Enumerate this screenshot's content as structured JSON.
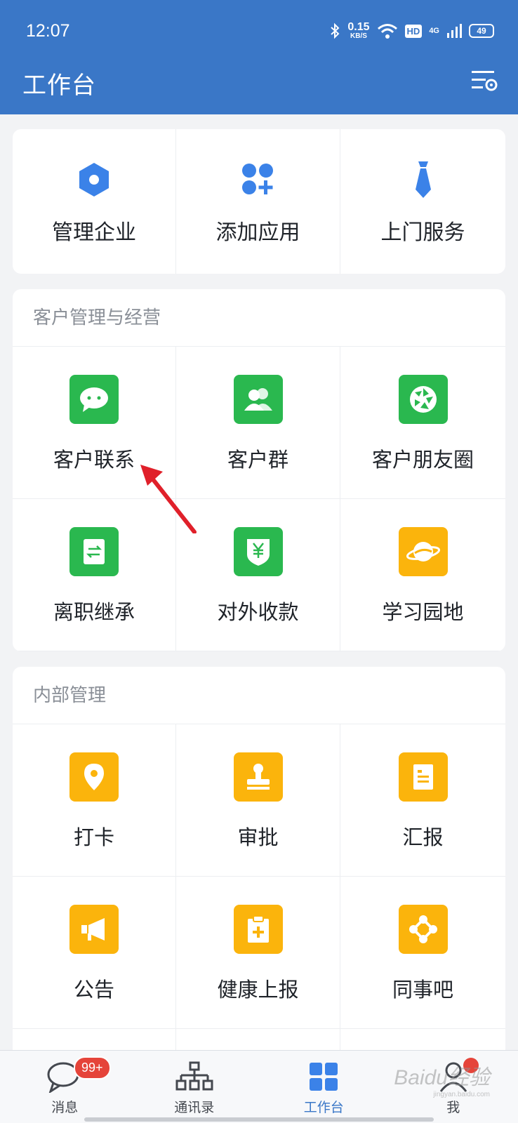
{
  "status_bar": {
    "time": "12:07",
    "speed": "0.15",
    "speed_unit": "KB/S",
    "hd": "HD",
    "network": "4G",
    "battery": "49"
  },
  "header": {
    "title": "工作台"
  },
  "quick_actions": [
    {
      "label": "管理企业",
      "icon": "hexagon-settings-icon"
    },
    {
      "label": "添加应用",
      "icon": "add-app-icon"
    },
    {
      "label": "上门服务",
      "icon": "necktie-icon"
    }
  ],
  "customer_section": {
    "title": "客户管理与经营",
    "items": [
      {
        "label": "客户联系",
        "icon": "chat-bubble-icon"
      },
      {
        "label": "客户群",
        "icon": "group-users-icon"
      },
      {
        "label": "客户朋友圈",
        "icon": "aperture-icon"
      },
      {
        "label": "离职继承",
        "icon": "transfer-doc-icon"
      },
      {
        "label": "对外收款",
        "icon": "yuan-shield-icon"
      },
      {
        "label": "学习园地",
        "icon": "planet-icon"
      }
    ]
  },
  "internal_section": {
    "title": "内部管理",
    "items": [
      {
        "label": "打卡",
        "icon": "location-pin-icon"
      },
      {
        "label": "审批",
        "icon": "stamp-icon"
      },
      {
        "label": "汇报",
        "icon": "report-doc-icon"
      },
      {
        "label": "公告",
        "icon": "megaphone-icon"
      },
      {
        "label": "健康上报",
        "icon": "clipboard-plus-icon"
      },
      {
        "label": "同事吧",
        "icon": "network-nodes-icon"
      }
    ]
  },
  "tabbar": {
    "tabs": [
      {
        "label": "消息",
        "badge": "99+"
      },
      {
        "label": "通讯录"
      },
      {
        "label": "工作台",
        "active": true
      },
      {
        "label": "我"
      }
    ]
  },
  "watermark": {
    "text": "Baidu经验",
    "sub": "jingyan.baidu.com"
  },
  "colors": {
    "header": "#3a77c7",
    "green": "#2ab84f",
    "amber": "#fbb40c",
    "badge": "#e5443a",
    "arrow": "#e0202a"
  }
}
